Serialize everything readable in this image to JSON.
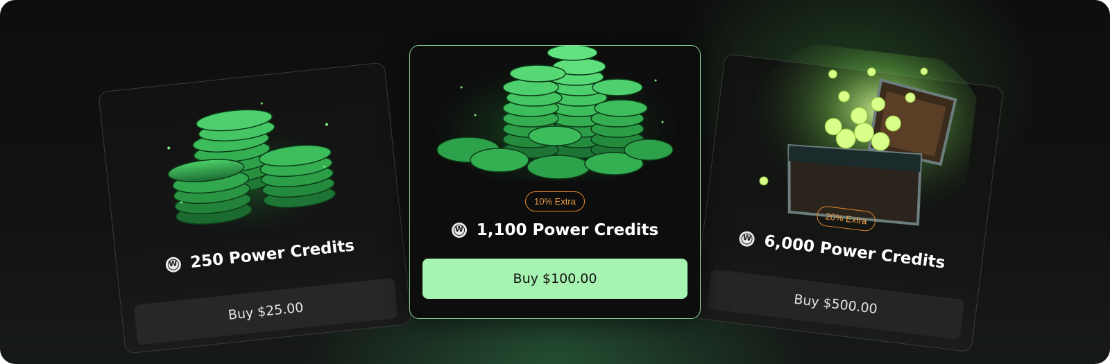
{
  "packages": [
    {
      "credits_label": "250 Power Credits",
      "buy_label": "Buy $25.00",
      "badge": ""
    },
    {
      "credits_label": "1,100 Power Credits",
      "buy_label": "Buy $100.00",
      "badge": "10% Extra"
    },
    {
      "credits_label": "6,000 Power Credits",
      "buy_label": "Buy $500.00",
      "badge": "20% Extra"
    }
  ],
  "icons": {
    "currency": "power-credit-coin-icon"
  },
  "colors": {
    "accent": "#a7f3b1",
    "badge": "#e58a2a",
    "chip_green": "#2e9a4c"
  }
}
